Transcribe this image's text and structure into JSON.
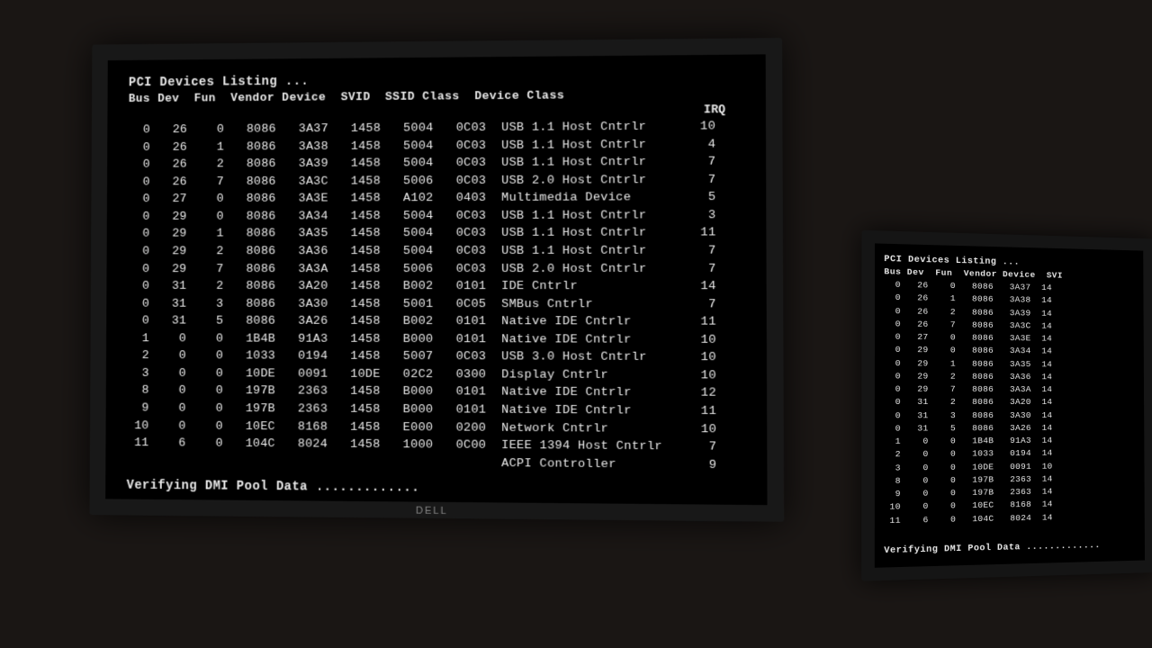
{
  "title": "PCI Devices Listing ...",
  "columns": [
    "Bus",
    "Dev",
    "Fun",
    "Vendor",
    "Device",
    "SVID",
    "SSID",
    "Class",
    "Device Class"
  ],
  "irq_header": "IRQ",
  "rows": [
    {
      "bus": "0",
      "dev": "26",
      "fun": "0",
      "vendor": "8086",
      "device": "3A37",
      "svid": "1458",
      "ssid": "5004",
      "class": "0C03",
      "device_class": "USB 1.1 Host Cntrlr",
      "irq": "10"
    },
    {
      "bus": "0",
      "dev": "26",
      "fun": "1",
      "vendor": "8086",
      "device": "3A38",
      "svid": "1458",
      "ssid": "5004",
      "class": "0C03",
      "device_class": "USB 1.1 Host Cntrlr",
      "irq": "4"
    },
    {
      "bus": "0",
      "dev": "26",
      "fun": "2",
      "vendor": "8086",
      "device": "3A39",
      "svid": "1458",
      "ssid": "5004",
      "class": "0C03",
      "device_class": "USB 1.1 Host Cntrlr",
      "irq": "7"
    },
    {
      "bus": "0",
      "dev": "26",
      "fun": "7",
      "vendor": "8086",
      "device": "3A3C",
      "svid": "1458",
      "ssid": "5006",
      "class": "0C03",
      "device_class": "USB 2.0 Host Cntrlr",
      "irq": "7"
    },
    {
      "bus": "0",
      "dev": "27",
      "fun": "0",
      "vendor": "8086",
      "device": "3A3E",
      "svid": "1458",
      "ssid": "A102",
      "class": "0403",
      "device_class": "Multimedia Device",
      "irq": "5"
    },
    {
      "bus": "0",
      "dev": "29",
      "fun": "0",
      "vendor": "8086",
      "device": "3A34",
      "svid": "1458",
      "ssid": "5004",
      "class": "0C03",
      "device_class": "USB 1.1 Host Cntrlr",
      "irq": "3"
    },
    {
      "bus": "0",
      "dev": "29",
      "fun": "1",
      "vendor": "8086",
      "device": "3A35",
      "svid": "1458",
      "ssid": "5004",
      "class": "0C03",
      "device_class": "USB 1.1 Host Cntrlr",
      "irq": "11"
    },
    {
      "bus": "0",
      "dev": "29",
      "fun": "2",
      "vendor": "8086",
      "device": "3A36",
      "svid": "1458",
      "ssid": "5004",
      "class": "0C03",
      "device_class": "USB 1.1 Host Cntrlr",
      "irq": "7"
    },
    {
      "bus": "0",
      "dev": "29",
      "fun": "7",
      "vendor": "8086",
      "device": "3A3A",
      "svid": "1458",
      "ssid": "5006",
      "class": "0C03",
      "device_class": "USB 2.0 Host Cntrlr",
      "irq": "7"
    },
    {
      "bus": "0",
      "dev": "31",
      "fun": "2",
      "vendor": "8086",
      "device": "3A20",
      "svid": "1458",
      "ssid": "B002",
      "class": "0101",
      "device_class": "IDE Cntrlr",
      "irq": "14"
    },
    {
      "bus": "0",
      "dev": "31",
      "fun": "3",
      "vendor": "8086",
      "device": "3A30",
      "svid": "1458",
      "ssid": "5001",
      "class": "0C05",
      "device_class": "SMBus Cntrlr",
      "irq": "7"
    },
    {
      "bus": "0",
      "dev": "31",
      "fun": "5",
      "vendor": "8086",
      "device": "3A26",
      "svid": "1458",
      "ssid": "B002",
      "class": "0101",
      "device_class": "Native IDE Cntrlr",
      "irq": "11"
    },
    {
      "bus": "1",
      "dev": "0",
      "fun": "0",
      "vendor": "1B4B",
      "device": "91A3",
      "svid": "1458",
      "ssid": "B000",
      "class": "0101",
      "device_class": "Native IDE Cntrlr",
      "irq": "10"
    },
    {
      "bus": "2",
      "dev": "0",
      "fun": "0",
      "vendor": "1033",
      "device": "0194",
      "svid": "1458",
      "ssid": "5007",
      "class": "0C03",
      "device_class": "USB 3.0 Host Cntrlr",
      "irq": "10"
    },
    {
      "bus": "3",
      "dev": "0",
      "fun": "0",
      "vendor": "10DE",
      "device": "0091",
      "svid": "10DE",
      "ssid": "02C2",
      "class": "0300",
      "device_class": "Display Cntrlr",
      "irq": "10"
    },
    {
      "bus": "8",
      "dev": "0",
      "fun": "0",
      "vendor": "197B",
      "device": "2363",
      "svid": "1458",
      "ssid": "B000",
      "class": "0101",
      "device_class": "Native IDE Cntrlr",
      "irq": "12"
    },
    {
      "bus": "9",
      "dev": "0",
      "fun": "0",
      "vendor": "197B",
      "device": "2363",
      "svid": "1458",
      "ssid": "B000",
      "class": "0101",
      "device_class": "Native IDE Cntrlr",
      "irq": "11"
    },
    {
      "bus": "10",
      "dev": "0",
      "fun": "0",
      "vendor": "10EC",
      "device": "8168",
      "svid": "1458",
      "ssid": "E000",
      "class": "0200",
      "device_class": "Network Cntrlr",
      "irq": "10"
    },
    {
      "bus": "11",
      "dev": "6",
      "fun": "0",
      "vendor": "104C",
      "device": "8024",
      "svid": "1458",
      "ssid": "1000",
      "class": "0C00",
      "device_class": "IEEE 1394 Host Cntrlr",
      "irq": "7"
    },
    {
      "bus": "",
      "dev": "",
      "fun": "",
      "vendor": "",
      "device": "",
      "svid": "",
      "ssid": "",
      "class": "",
      "device_class": "ACPI Controller",
      "irq": "9"
    }
  ],
  "footer": "Verifying DMI Pool Data .............",
  "brand": "DELL"
}
